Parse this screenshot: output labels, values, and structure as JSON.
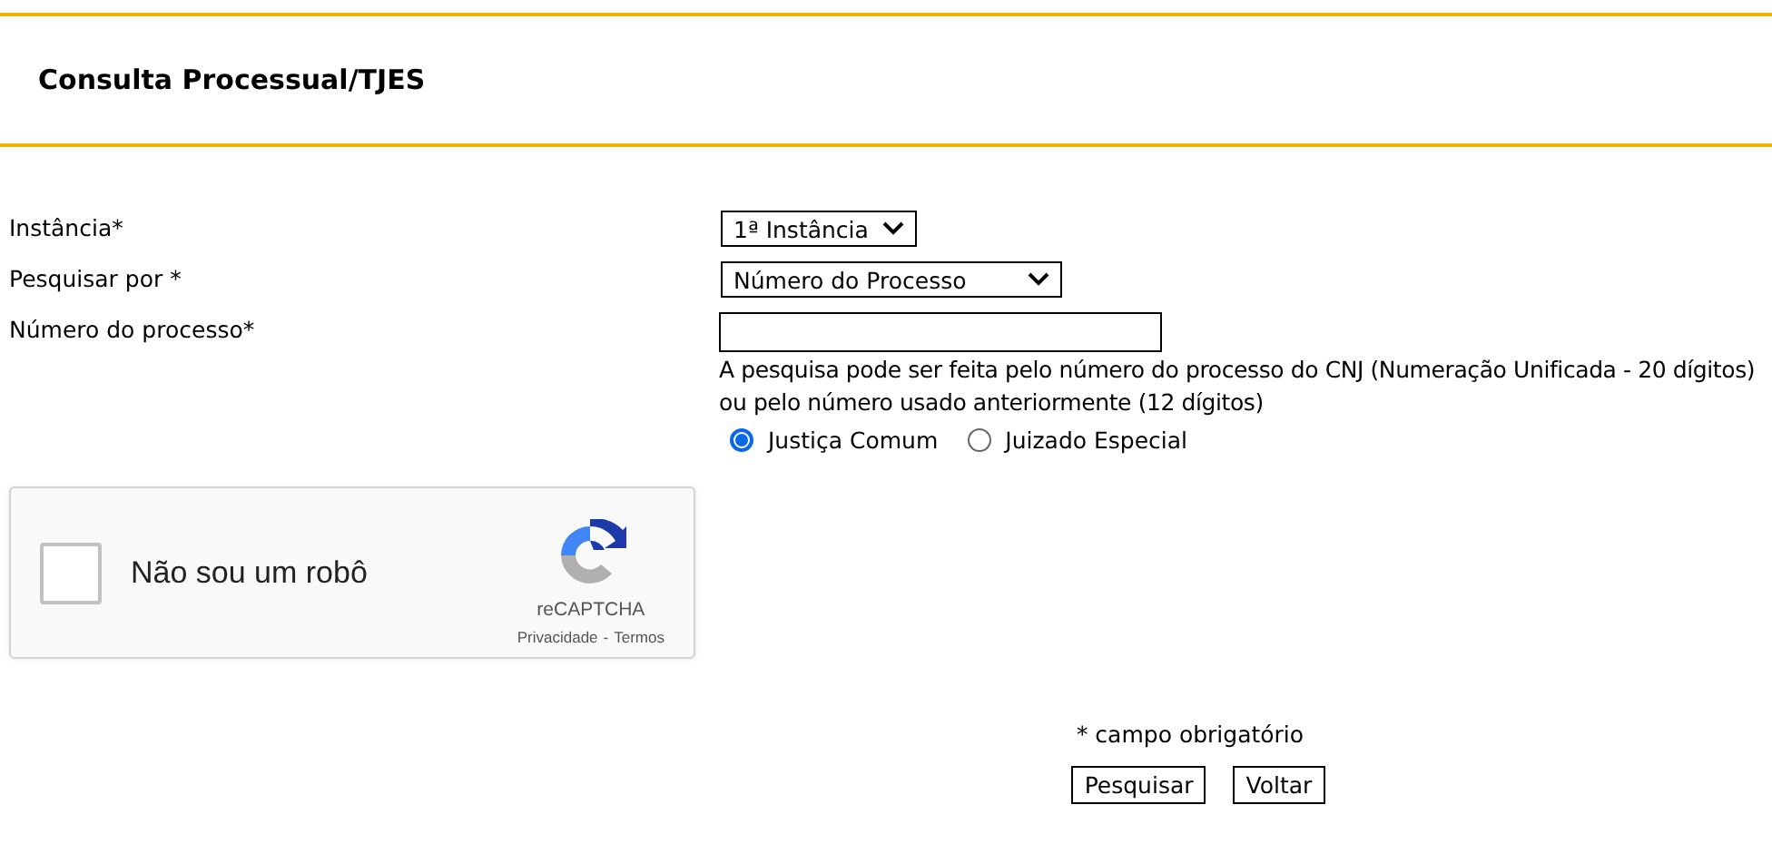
{
  "header": {
    "title": "Consulta Processual/TJES"
  },
  "form": {
    "fields": [
      {
        "kind": "select",
        "label": "Instância*",
        "value": "1ª Instância"
      },
      {
        "kind": "select",
        "label": "Pesquisar por *",
        "value": "Número do Processo"
      },
      {
        "kind": "text",
        "label": "Número do processo*",
        "help": [
          "A pesquisa pode ser feita pelo número do processo do CNJ (Numeração Unificada - 20 dígitos)",
          "ou pelo número usado anteriormente (12 dígitos)"
        ],
        "options": [
          {
            "label": "Justiça Comum",
            "selected": true
          },
          {
            "label": "Juizado Especial",
            "selected": false
          }
        ]
      }
    ]
  },
  "captcha": {
    "label": "Não sou um robô",
    "checked": false,
    "brand": "reCAPTCHA",
    "links": [
      "Privacidade",
      "Termos"
    ],
    "separator": "-"
  },
  "required_note": "* campo obrigatório",
  "buttons": [
    "Pesquisar",
    "Voltar"
  ]
}
